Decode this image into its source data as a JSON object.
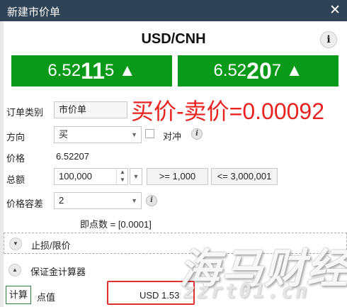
{
  "window": {
    "title": "新建市价单",
    "close_glyph": "✕"
  },
  "instrument": {
    "pair": "USD/CNH",
    "info_glyph": "i"
  },
  "quotes": {
    "sell": {
      "prefix": "6.52",
      "big": "11",
      "suffix": "5",
      "arrow": "▲"
    },
    "buy": {
      "prefix": "6.52",
      "big": "20",
      "suffix": "7",
      "arrow": "▲"
    },
    "color": "#0a9a19"
  },
  "annotation": {
    "spread_text": "买价-卖价=0.00092",
    "color": "#e8231f"
  },
  "form": {
    "order_type": {
      "label": "订单类别",
      "value": "市价单"
    },
    "direction": {
      "label": "方向",
      "value": "买",
      "hedge_label": "对冲"
    },
    "price": {
      "label": "价格",
      "value": "6.52207"
    },
    "amount": {
      "label": "总额",
      "value": "100,000",
      "min_button": ">= 1,000",
      "max_button": "<= 3,000,001"
    },
    "slippage": {
      "label": "价格容差",
      "value": "2",
      "pip_note": "即点数 = [0.0001]"
    }
  },
  "sections": {
    "stop_limit": {
      "label": "止损/限价"
    },
    "margin_calc": {
      "label": "保证金计算器"
    }
  },
  "calculator": {
    "calc_button": "计算",
    "pip_value_label": "点值",
    "pip_value": "USD 1.53"
  },
  "watermark": {
    "cn": "海马财经",
    "url": "zzrt01.cn"
  },
  "icons": {
    "close": "close-icon",
    "info": "info-icon",
    "arrow_up": "arrow-up-icon",
    "dropdown": "chevron-down-icon",
    "expand": "chevron-down-circle-icon",
    "collapse": "chevron-up-circle-icon"
  }
}
